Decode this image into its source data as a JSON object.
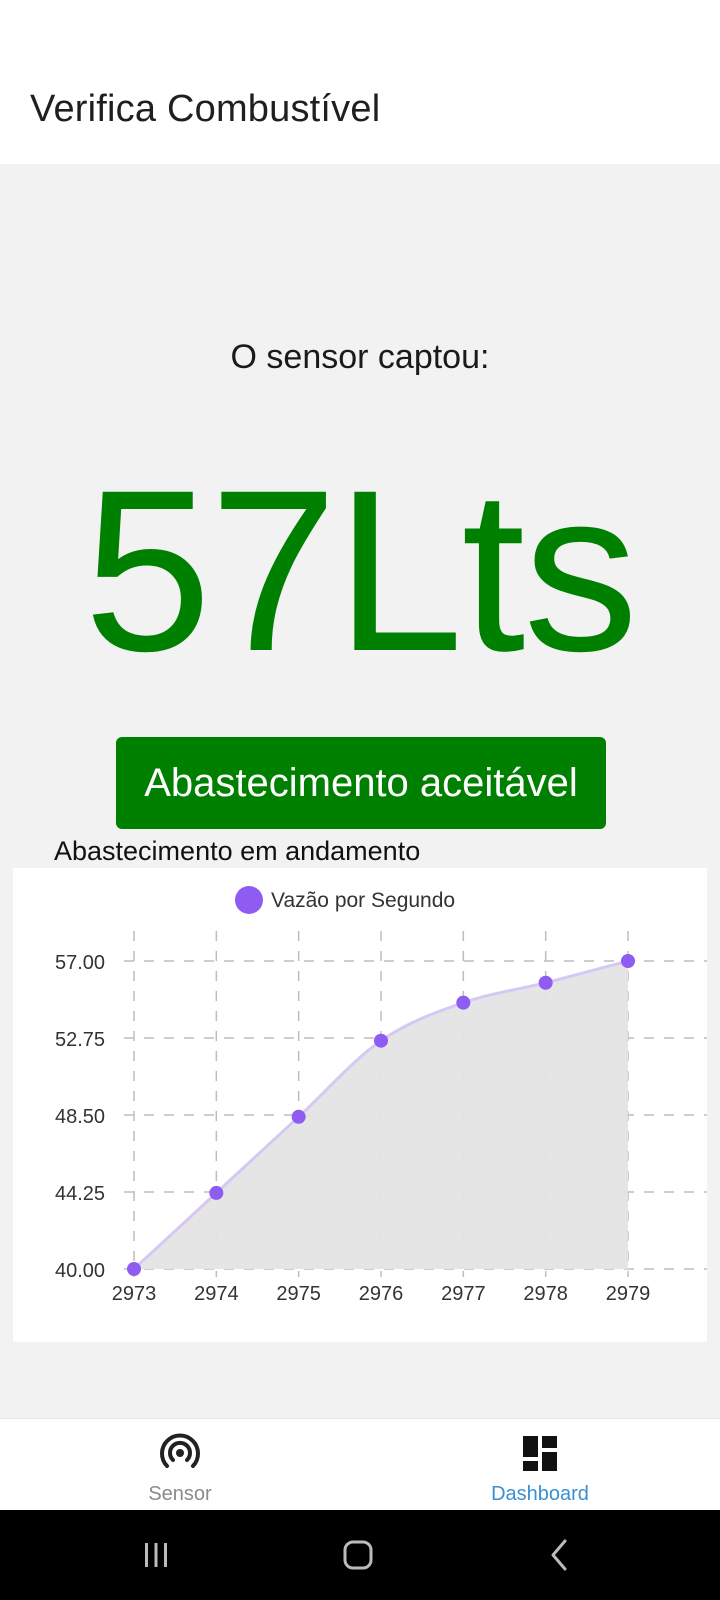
{
  "header": {
    "title": "Verifica Combustível"
  },
  "reading": {
    "caption": "O sensor captou:",
    "value": "57Lts",
    "color": "#008000"
  },
  "status": {
    "label": "Abastecimento aceitável",
    "color": "#008000"
  },
  "section_title": "Abastecimento em andamento",
  "chart_data": {
    "type": "area",
    "x": [
      2973,
      2974,
      2975,
      2976,
      2977,
      2978,
      2979
    ],
    "series": [
      {
        "name": "Vazão por Segundo",
        "values": [
          40.0,
          44.2,
          48.4,
          52.6,
          54.7,
          55.8,
          57.0
        ],
        "color": "#8e5cf0"
      }
    ],
    "y_ticks": [
      "57.00",
      "52.75",
      "48.50",
      "44.25",
      "40.00"
    ],
    "ylim": [
      40,
      57
    ],
    "grid": true,
    "grid_style": "dashed",
    "legend_position": "top-center",
    "fill_color": "#e4e4e4",
    "title": "",
    "xlabel": "",
    "ylabel": ""
  },
  "nav": {
    "items": [
      {
        "label": "Sensor",
        "icon": "sensor-broadcast-icon",
        "active": false
      },
      {
        "label": "Dashboard",
        "icon": "dashboard-grid-icon",
        "active": true
      }
    ]
  },
  "system_nav": {
    "recents": "recents-icon",
    "home": "home-icon",
    "back": "back-icon"
  }
}
